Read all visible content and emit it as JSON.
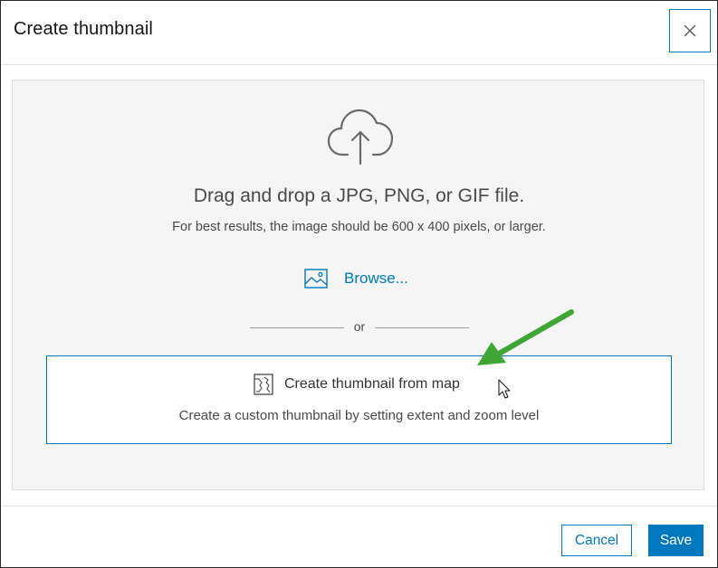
{
  "dialog": {
    "title": "Create thumbnail",
    "close_icon": "close-icon"
  },
  "dropzone": {
    "upload_icon": "cloud-upload-icon",
    "drag_text": "Drag and drop a JPG, PNG, or GIF file.",
    "hint_text": "For best results, the image should be 600 x 400 pixels, or larger.",
    "browse_icon": "image-icon",
    "browse_label": "Browse...",
    "or_text": "or"
  },
  "map_option": {
    "icon": "map-icon",
    "title": "Create thumbnail from map",
    "description": "Create a custom thumbnail by setting extent and zoom level"
  },
  "footer": {
    "cancel_label": "Cancel",
    "save_label": "Save"
  },
  "colors": {
    "accent": "#0079c1",
    "annotation_arrow": "#3fa535",
    "dropzone_bg": "#f5f5f5"
  }
}
